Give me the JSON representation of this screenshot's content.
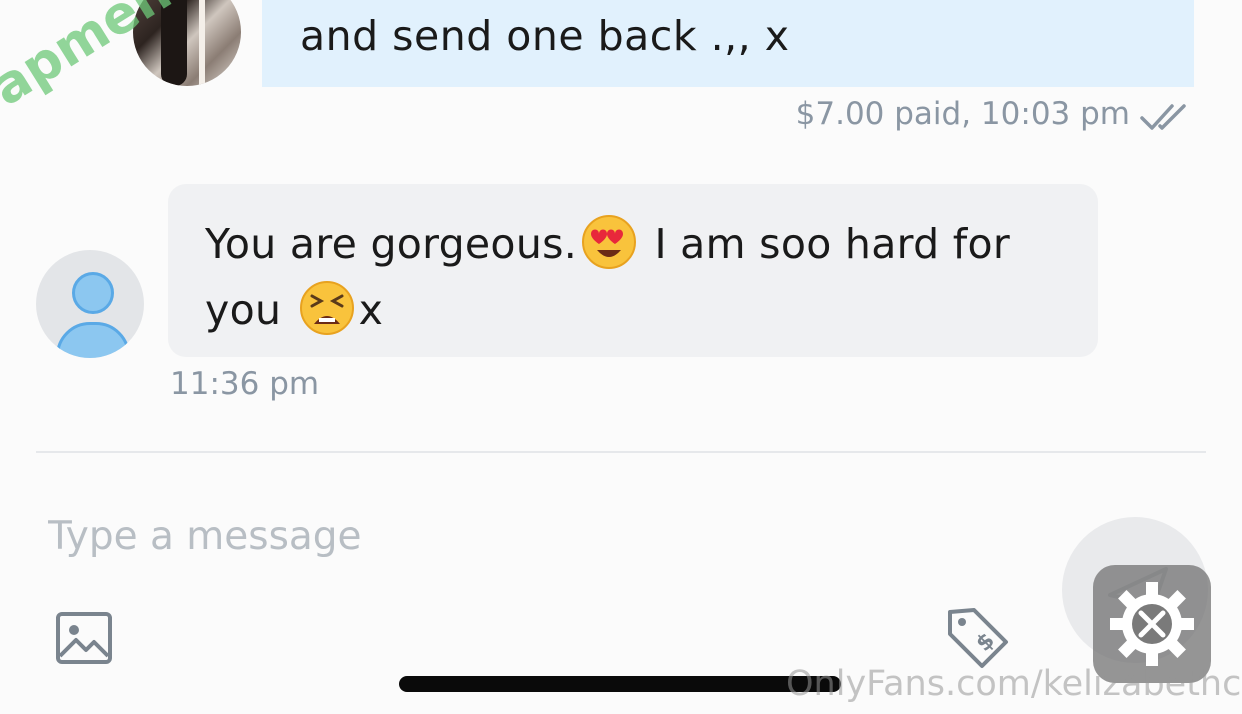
{
  "sent_message": {
    "text": "and send one back .,, x",
    "meta": "$7.00 paid, 10:03 pm",
    "status_icon": "double-check-icon"
  },
  "received_message": {
    "line1_before": "You are gorgeous.",
    "line1_emoji": "heart-eyes-emoji",
    "line1_after": " I am soo hard for",
    "line2_before": "you ",
    "line2_emoji": "tired-face-emoji",
    "line2_after": "x",
    "time": "11:36 pm"
  },
  "composer": {
    "placeholder": "Type a message",
    "value": ""
  },
  "watermarks": {
    "left": "fapmenu.com",
    "bottom": "OnlyFans.com/kelizabethc"
  },
  "colors": {
    "sent_bubble": "#e1f1fd",
    "received_bubble": "#f0f1f3",
    "meta_text": "#8a96a3",
    "icon_gray": "#7a848e"
  }
}
